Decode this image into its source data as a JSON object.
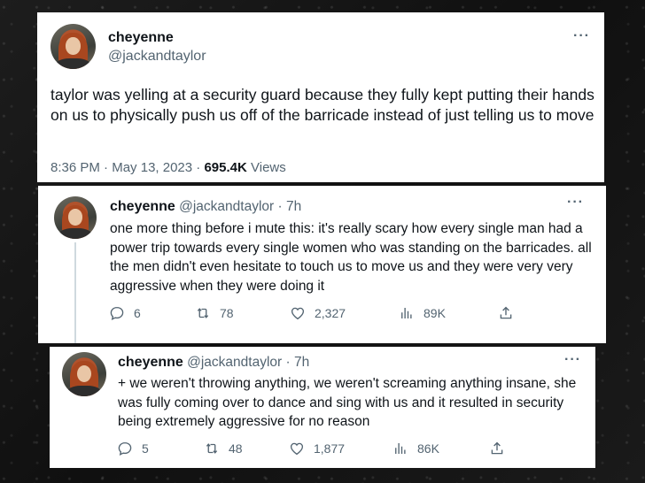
{
  "main_tweet": {
    "display_name": "cheyenne",
    "handle": "@jackandtaylor",
    "text": "taylor was yelling at a security guard because they fully kept putting their hands on us to physically push us off of the barricade instead of just telling us to move",
    "time": "8:36 PM",
    "sep1": "·",
    "date": "May 13, 2023",
    "sep2": "·",
    "views_count": "695.4K",
    "views_label": "Views",
    "more": "···"
  },
  "reply1": {
    "display_name": "cheyenne",
    "handle": "@jackandtaylor",
    "dot": "·",
    "time": "7h",
    "text": "one more thing before i mute this: it's really scary how every single man had a power trip towards every single women who was standing on the barricades. all the men didn't even hesitate to touch us to move us  and they were very very aggressive when they were doing it",
    "more": "···",
    "replies": "6",
    "retweets": "78",
    "likes": "2,327",
    "views": "89K"
  },
  "reply2": {
    "display_name": "cheyenne",
    "handle": "@jackandtaylor",
    "dot": "·",
    "time": "7h",
    "text": "+ we weren't throwing anything, we weren't screaming anything insane, she was fully coming over to dance and sing with us and it resulted in security being extremely aggressive for no reason",
    "more": "···",
    "replies": "5",
    "retweets": "48",
    "likes": "1,877",
    "views": "86K"
  },
  "icons": {
    "reply": "reply-icon",
    "retweet": "retweet-icon",
    "like": "heart-icon",
    "views": "views-chart-icon",
    "share": "share-icon"
  },
  "colors": {
    "text": "#0f1419",
    "secondary": "#536471",
    "card": "#ffffff",
    "background": "#151515"
  }
}
